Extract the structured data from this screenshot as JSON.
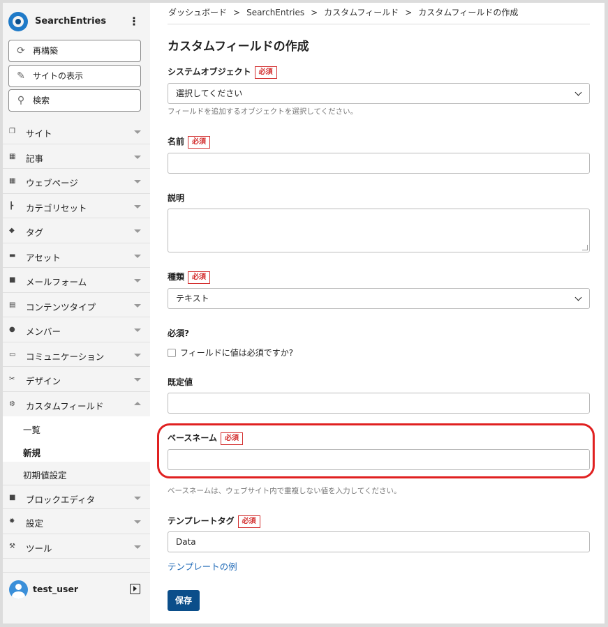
{
  "brand": {
    "name": "SearchEntries",
    "menu_icon": "⋮"
  },
  "sidebar_buttons": [
    {
      "label": "再構築",
      "icon": "refresh-icon"
    },
    {
      "label": "サイトの表示",
      "icon": "external-view-icon"
    },
    {
      "label": "検索",
      "icon": "search-icon"
    }
  ],
  "menu": [
    {
      "label": "サイト",
      "icon": "site-icon"
    },
    {
      "label": "記事",
      "icon": "entry-icon"
    },
    {
      "label": "ウェブページ",
      "icon": "page-icon"
    },
    {
      "label": "カテゴリセット",
      "icon": "category-icon"
    },
    {
      "label": "タグ",
      "icon": "tag-icon"
    },
    {
      "label": "アセット",
      "icon": "asset-icon"
    },
    {
      "label": "メールフォーム",
      "icon": "form-icon"
    },
    {
      "label": "コンテンツタイプ",
      "icon": "content-type-icon"
    },
    {
      "label": "メンバー",
      "icon": "user-icon"
    },
    {
      "label": "コミュニケーション",
      "icon": "comment-icon"
    },
    {
      "label": "デザイン",
      "icon": "design-icon"
    },
    {
      "label": "カスタムフィールド",
      "icon": "custom-field-icon"
    }
  ],
  "submenu": [
    "一覧",
    "新規",
    "初期値設定"
  ],
  "menu_after": [
    {
      "label": "ブロックエディタ",
      "icon": "block-editor-icon"
    },
    {
      "label": "設定",
      "icon": "gear-icon"
    },
    {
      "label": "ツール",
      "icon": "wrench-icon"
    }
  ],
  "user": {
    "name": "test_user"
  },
  "breadcrumb": [
    "ダッシュボード",
    "SearchEntries",
    "カスタムフィールド",
    "カスタムフィールドの作成"
  ],
  "breadcrumb_sep": ">",
  "page_title": "カスタムフィールドの作成",
  "required_badge": "必須",
  "form": {
    "system_object": {
      "label": "システムオブジェクト",
      "value": "選択してください",
      "hint": "フィールドを追加するオブジェクトを選択してください。"
    },
    "name": {
      "label": "名前",
      "value": ""
    },
    "description": {
      "label": "説明",
      "value": ""
    },
    "type": {
      "label": "種類",
      "value": "テキスト"
    },
    "required": {
      "label": "必須?",
      "checkbox_label": "フィールドに値は必須ですか?"
    },
    "default": {
      "label": "既定値",
      "value": ""
    },
    "basename": {
      "label": "ベースネーム",
      "value": "",
      "hint": "ベースネームは、ウェブサイト内で重複しない値を入力してください。"
    },
    "template_tag": {
      "label": "テンプレートタグ",
      "value": "Data",
      "example_link": "テンプレートの例"
    },
    "save_label": "保存"
  },
  "highlight_color": "#e02020",
  "accent_color": "#0b4e8a"
}
